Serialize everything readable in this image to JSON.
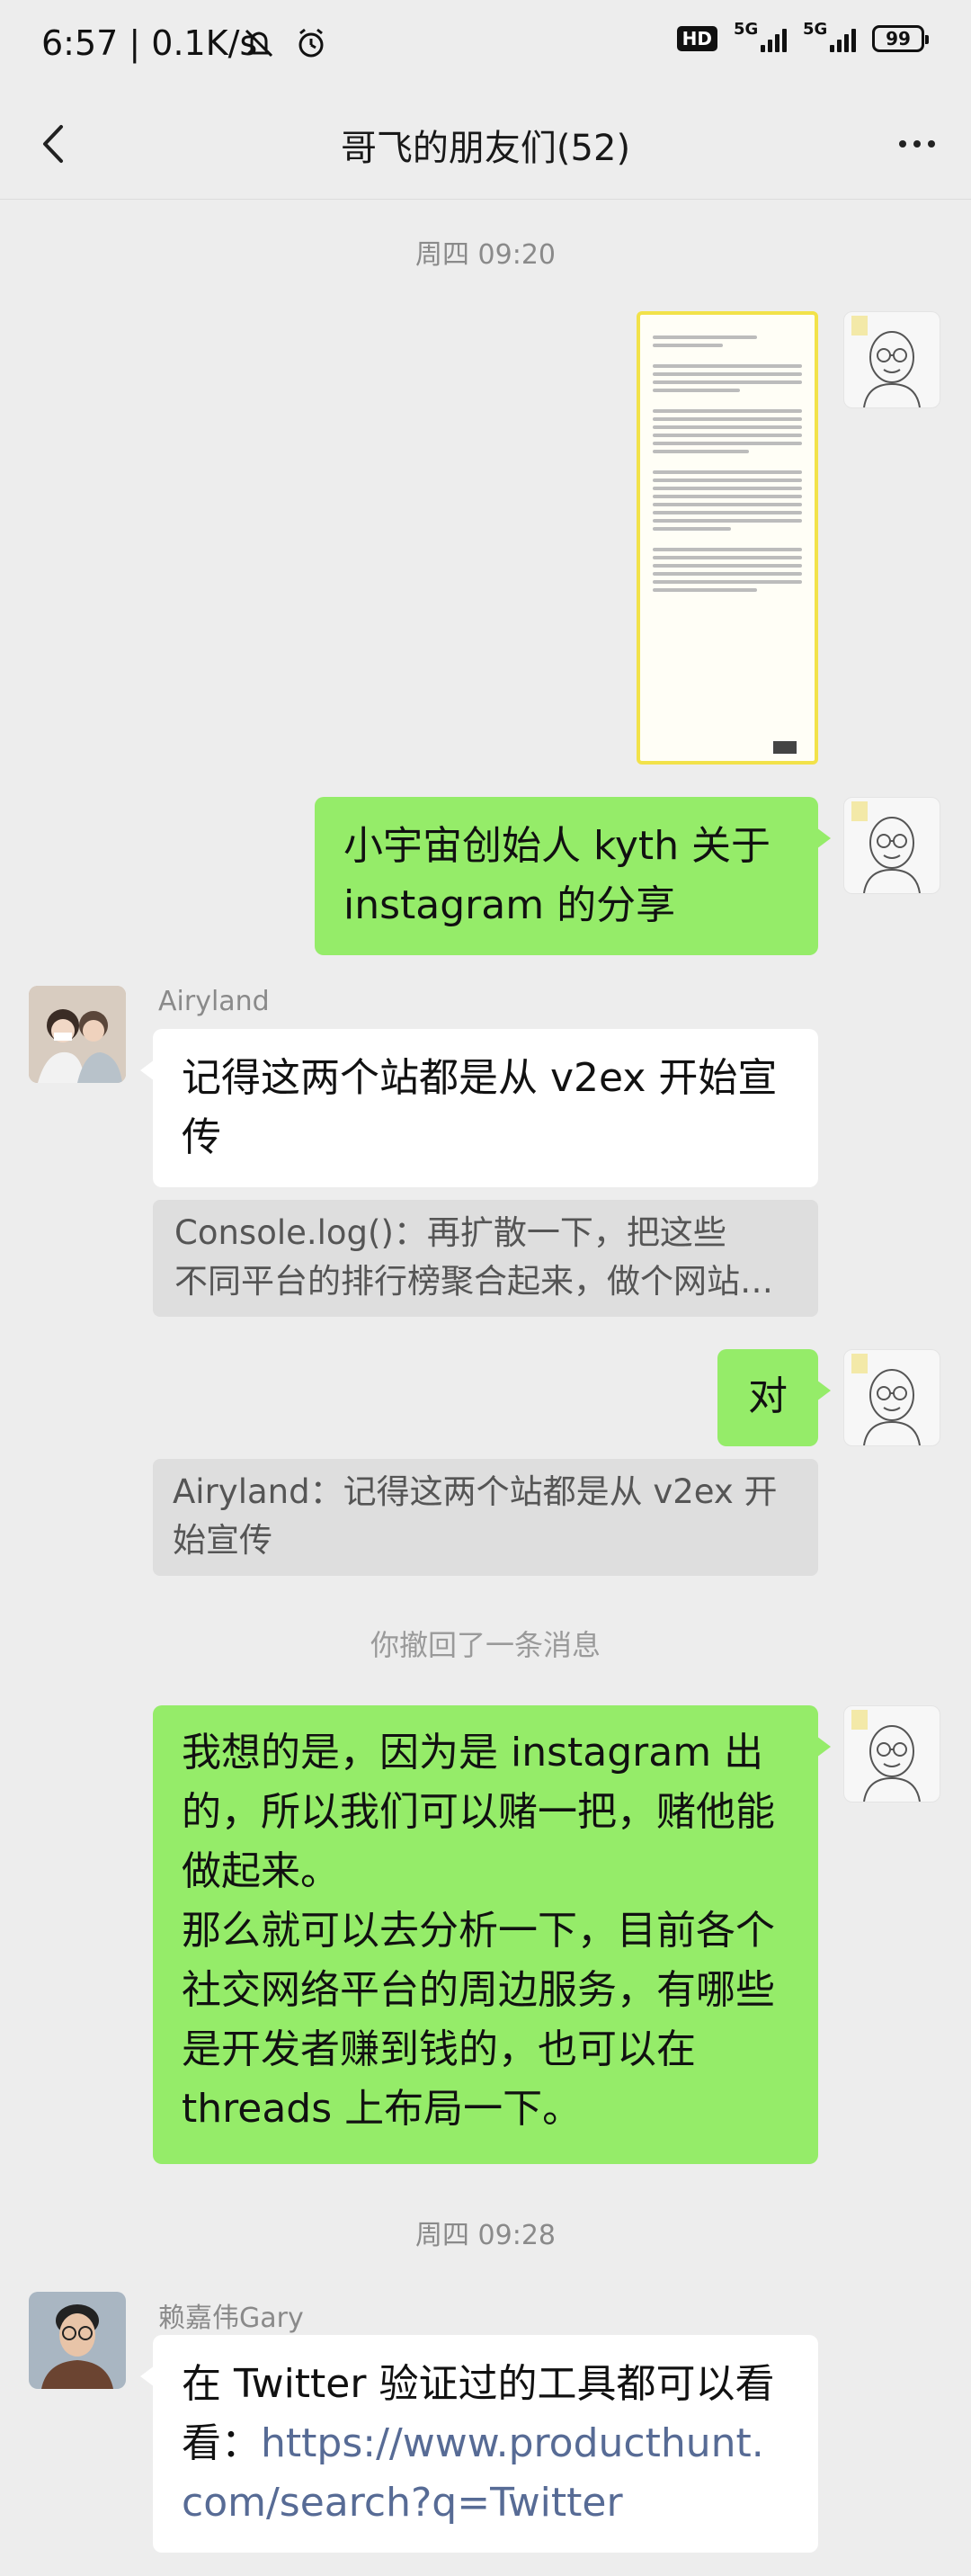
{
  "status_bar": {
    "time_speed": "6:57 | 0.1K/s",
    "hd_label": "HD",
    "net1": "5G",
    "net2": "5G",
    "battery": "99"
  },
  "header": {
    "title": "哥飞的朋友们(52)"
  },
  "messages": {
    "time1": "周四 09:20",
    "me_msg1": "小宇宙创始人 kyth 关于",
    "me_msg1b": "instagram 的分享",
    "airy_name": "Airyland",
    "airy_msg_l1": "记得这两个站都是从 v2ex 开始宣",
    "airy_msg_l2": "传",
    "quote1_l1": "Console.log()：再扩散一下，把这些",
    "quote1_l2": "不同平台的排行榜聚合起来，做个网站…",
    "me_msg2": "对",
    "quote2_l1": "Airyland：记得这两个站都是从 v2ex 开",
    "quote2_l2": "始宣传",
    "recall": "你撤回了一条消息",
    "me_long_l1": "我想的是，因为是 instagram 出",
    "me_long_l2": "的，所以我们可以赌一把，赌他能",
    "me_long_l3": "做起来。",
    "me_long_l4": "那么就可以去分析一下，目前各个",
    "me_long_l5": "社交网络平台的周边服务，有哪些",
    "me_long_l6": "是开发者赚到钱的，也可以在",
    "me_long_l7": "threads 上布局一下。",
    "time2": "周四 09:28",
    "gary_name": "赖嘉伟Gary",
    "gary_l1": "在 Twitter 验证过的工具都可以看",
    "gary_l2_prefix": "看：",
    "gary_l2_link": "https://www.producthunt.",
    "gary_l3_link": "com/search?q=Twitter"
  },
  "colors": {
    "me_bubble": "#95ec69",
    "other_bubble": "#ffffff",
    "link": "#576b95",
    "background": "#ededed"
  }
}
